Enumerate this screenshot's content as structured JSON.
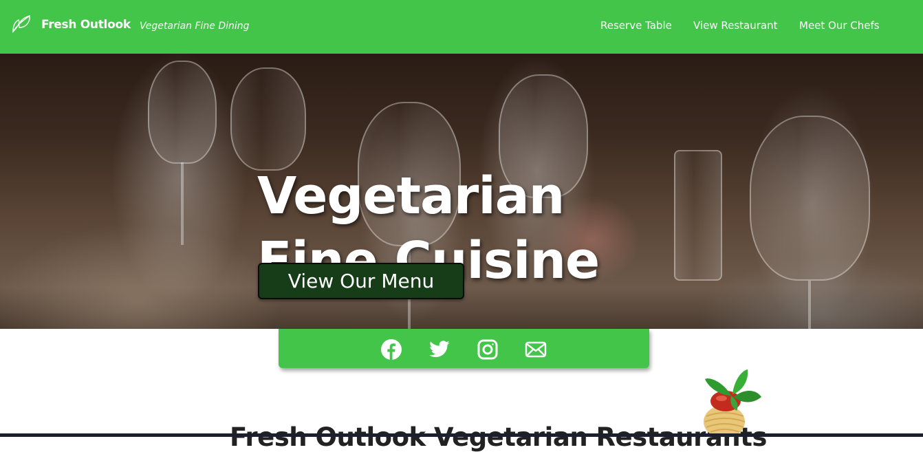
{
  "navbar": {
    "brand_name": "Fresh Outlook",
    "brand_tagline": "Vegetarian Fine Dining",
    "links": [
      {
        "label": "Reserve Table"
      },
      {
        "label": "View Restaurant"
      },
      {
        "label": "Meet Our Chefs"
      }
    ],
    "background_color": "#43c549",
    "logo_icon": "leaf-icon"
  },
  "hero": {
    "title_line1": "Vegetarian",
    "title_line2": "Fine Cuisine",
    "button_label": "View Our Menu",
    "button_color": "#163c18",
    "background_image": "dining-table-wine-glasses-photo"
  },
  "social": {
    "icons": [
      "facebook-icon",
      "twitter-icon",
      "instagram-icon",
      "email-icon"
    ]
  },
  "section": {
    "heading": "Fresh Outlook Vegetarian Restaurants",
    "decoration_icon": "pasta-icon"
  }
}
